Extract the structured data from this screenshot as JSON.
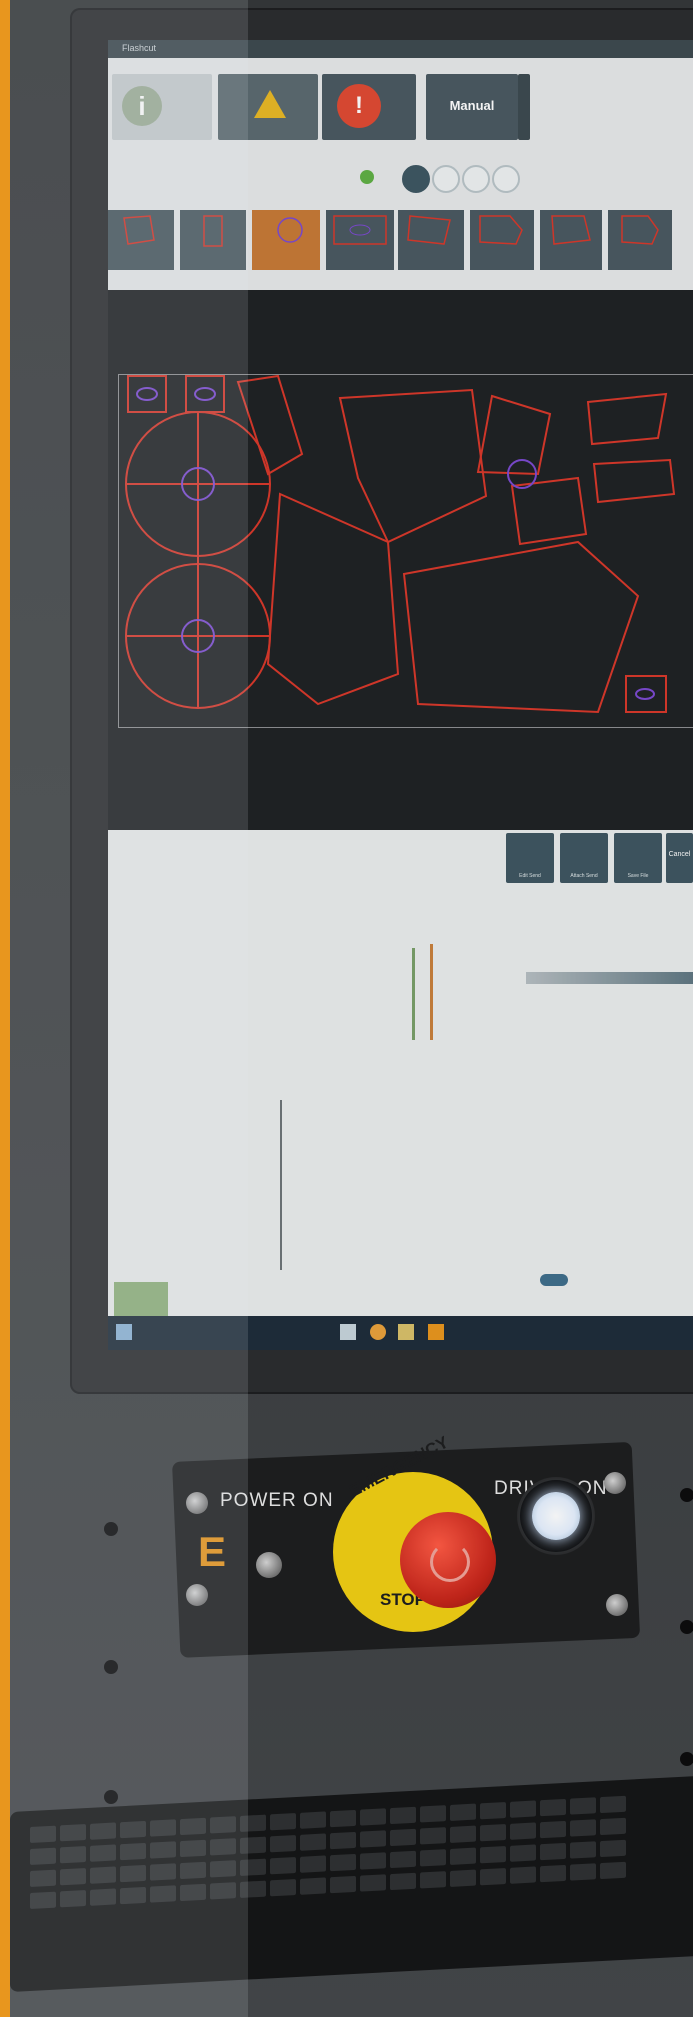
{
  "screen": {
    "title": "Flashcut",
    "top_buttons": {
      "manual_label": "Manual"
    },
    "action_buttons": [
      "Edit Send",
      "Attach Send",
      "Save File",
      "Cancel"
    ]
  },
  "panel": {
    "power_label": "POWER ON",
    "drives_label": "DRIVES ON",
    "estop_top_label": "EMERGENCY",
    "estop_bottom_label": "STOP"
  },
  "colors": {
    "accent": "#e8961e",
    "screen_dark": "#3e4a50",
    "estop_red": "#d42e20",
    "estop_yellow": "#f1cf14",
    "cad_line": "#d8382b"
  }
}
